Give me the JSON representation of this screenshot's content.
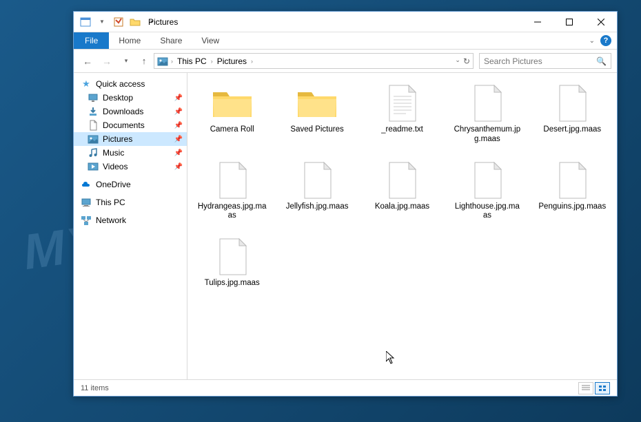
{
  "watermark": "MYANTISPYWARE.COM",
  "window": {
    "title": "Pictures"
  },
  "ribbon": {
    "file": "File",
    "tabs": [
      "Home",
      "Share",
      "View"
    ]
  },
  "breadcrumb": {
    "items": [
      "This PC",
      "Pictures"
    ]
  },
  "search": {
    "placeholder": "Search Pictures"
  },
  "sidebar": {
    "quick_access": "Quick access",
    "quick_items": [
      {
        "label": "Desktop",
        "icon": "desktop"
      },
      {
        "label": "Downloads",
        "icon": "downloads"
      },
      {
        "label": "Documents",
        "icon": "documents"
      },
      {
        "label": "Pictures",
        "icon": "pictures",
        "active": true
      },
      {
        "label": "Music",
        "icon": "music"
      },
      {
        "label": "Videos",
        "icon": "videos"
      }
    ],
    "onedrive": "OneDrive",
    "this_pc": "This PC",
    "network": "Network"
  },
  "files": [
    {
      "name": "Camera Roll",
      "type": "folder"
    },
    {
      "name": "Saved Pictures",
      "type": "folder"
    },
    {
      "name": "_readme.txt",
      "type": "text"
    },
    {
      "name": "Chrysanthemum.jpg.maas",
      "type": "blank"
    },
    {
      "name": "Desert.jpg.maas",
      "type": "blank"
    },
    {
      "name": "Hydrangeas.jpg.maas",
      "type": "blank"
    },
    {
      "name": "Jellyfish.jpg.maas",
      "type": "blank"
    },
    {
      "name": "Koala.jpg.maas",
      "type": "blank"
    },
    {
      "name": "Lighthouse.jpg.maas",
      "type": "blank"
    },
    {
      "name": "Penguins.jpg.maas",
      "type": "blank"
    },
    {
      "name": "Tulips.jpg.maas",
      "type": "blank"
    }
  ],
  "status": {
    "count": "11 items"
  }
}
